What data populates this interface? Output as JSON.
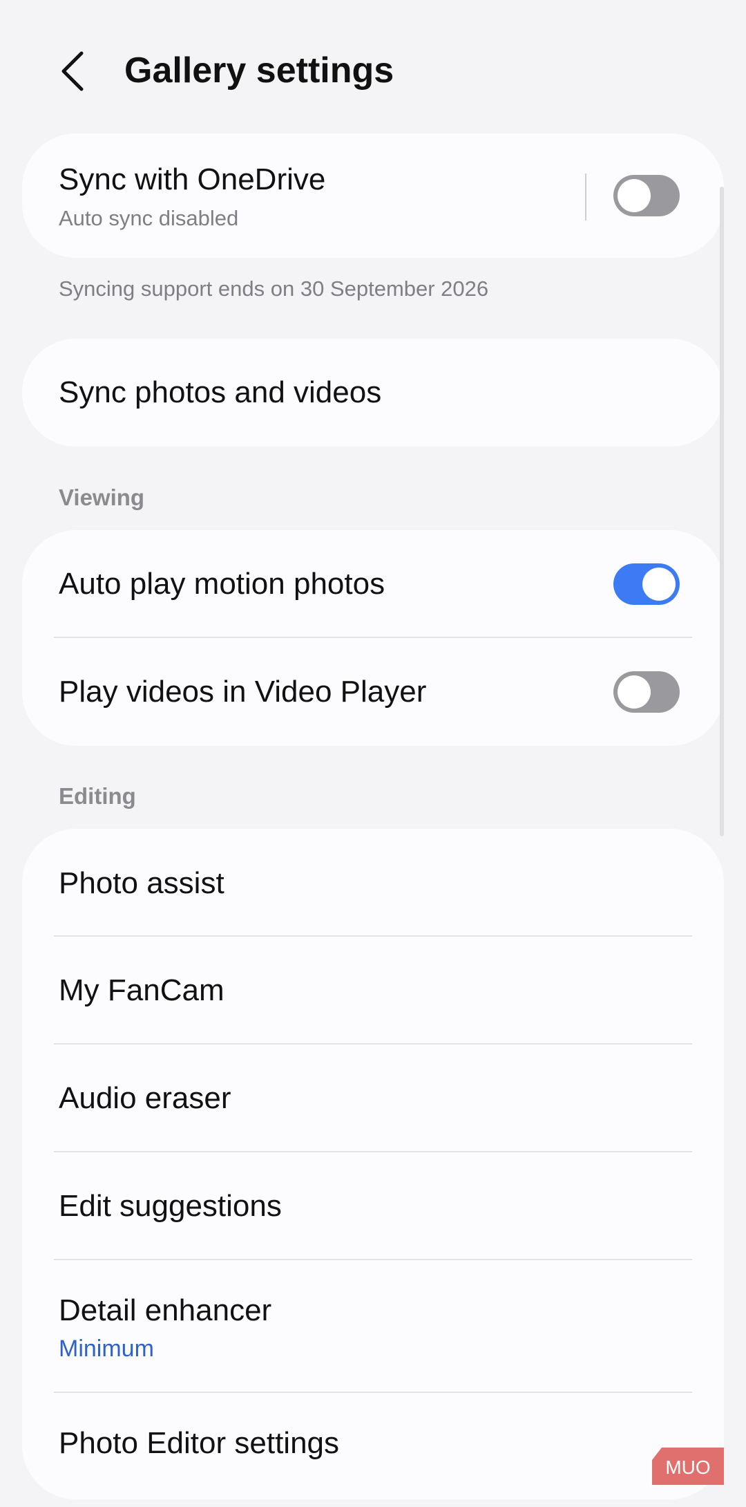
{
  "header": {
    "title": "Gallery settings",
    "back_icon": "chevron-left-icon"
  },
  "onedrive": {
    "label": "Sync with OneDrive",
    "status": "Auto sync disabled",
    "toggle_on": false,
    "note": "Syncing support ends on 30 September 2026"
  },
  "sync_photos": {
    "label": "Sync photos and videos"
  },
  "viewing": {
    "header": "Viewing",
    "items": [
      {
        "label": "Auto play motion photos",
        "toggle_on": true
      },
      {
        "label": "Play videos in Video Player",
        "toggle_on": false
      }
    ]
  },
  "editing": {
    "header": "Editing",
    "items": [
      {
        "label": "Photo assist"
      },
      {
        "label": "My FanCam"
      },
      {
        "label": "Audio eraser"
      },
      {
        "label": "Edit suggestions"
      },
      {
        "label": "Detail enhancer",
        "value": "Minimum"
      },
      {
        "label": "Photo Editor settings"
      }
    ]
  },
  "watermark": {
    "text": "MUO"
  },
  "colors": {
    "background": "#f4f4f6",
    "card": "#fcfcfe",
    "accent": "#3d7bf5",
    "value_text": "#2f62c8",
    "toggle_off": "#9a9a9e",
    "watermark": "#e0706e"
  }
}
